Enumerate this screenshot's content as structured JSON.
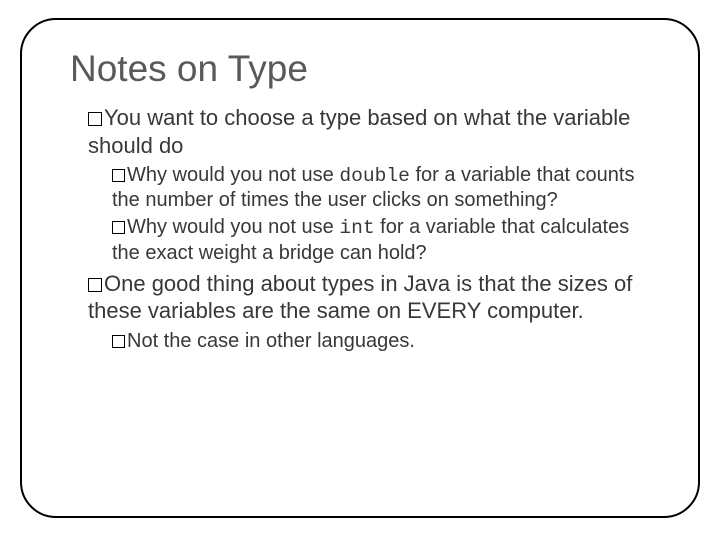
{
  "slide": {
    "title": "Notes on Type",
    "items": [
      {
        "text": "You want to choose a type based on what the variable should do",
        "children": [
          {
            "pre": "Why would you not use ",
            "code": "double",
            "post": " for a variable that counts the number of times the user clicks on something?"
          },
          {
            "pre": "Why would you not use ",
            "code": "int",
            "post": " for a variable that calculates the exact weight a bridge can hold?"
          }
        ]
      },
      {
        "text": "One good thing about types in Java is that the sizes of these variables are the same on EVERY computer.",
        "children": [
          {
            "pre": "Not the case in other languages.",
            "code": "",
            "post": ""
          }
        ]
      }
    ]
  }
}
